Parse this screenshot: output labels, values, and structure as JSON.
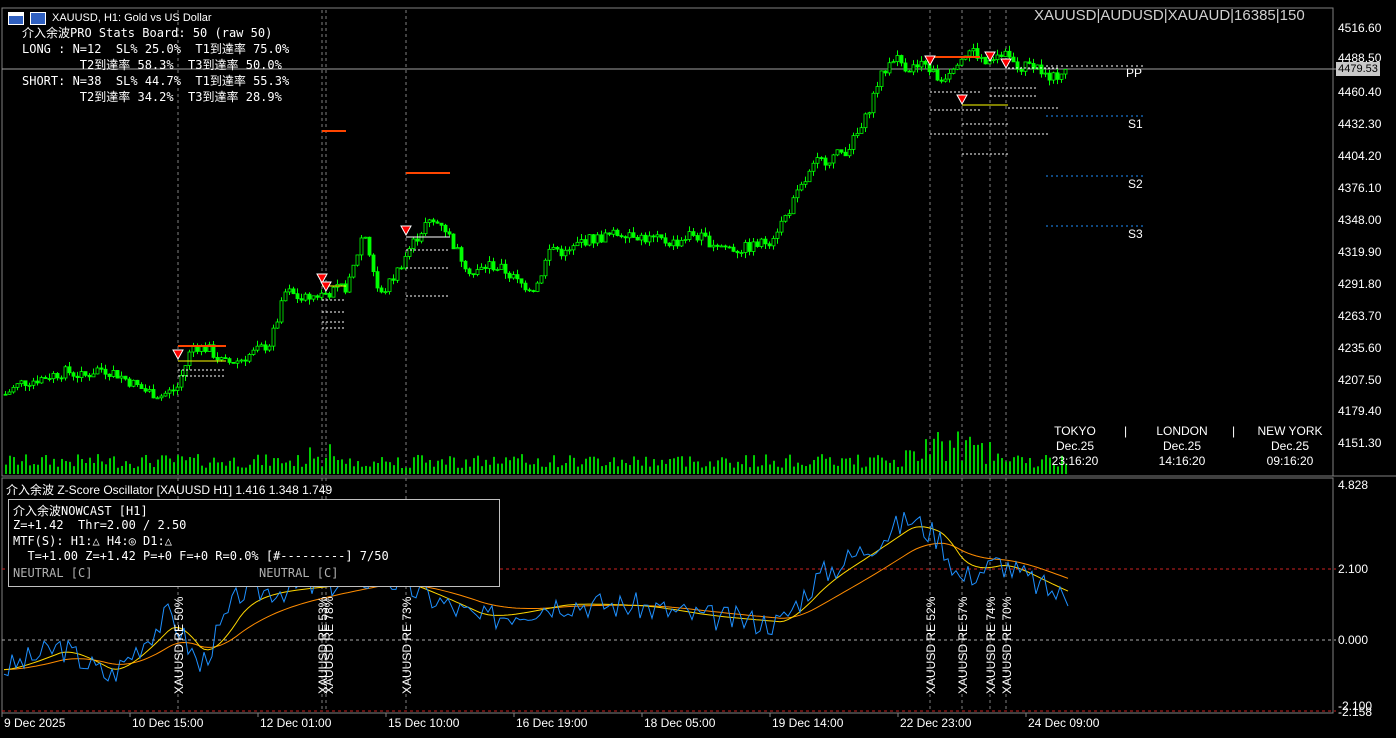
{
  "window": {
    "title": "XAUUSD, H1:  Gold vs US Dollar",
    "symbol_header": "XAUUSD|AUDUSD|XAUAUD|16385|150"
  },
  "stats_board": {
    "line1": "介入余波PRO Stats Board: 50 (raw 50)",
    "line2": "LONG : N=12  SL% 25.0%  T1到達率 75.0%",
    "line3": "        T2到達率 58.3%  T3到達率 50.0%",
    "line4": "SHORT: N=38  SL% 44.7%  T1到達率 55.3%",
    "line5": "        T2到達率 34.2%  T3到達率 28.9%"
  },
  "price_axis": {
    "labels": [
      "4516.60",
      "4488.50",
      "4460.40",
      "4432.30",
      "4404.20",
      "4376.10",
      "4348.00",
      "4319.90",
      "4291.80",
      "4263.70",
      "4235.60",
      "4207.50",
      "4179.40",
      "4151.30"
    ],
    "current_price": "4479.53"
  },
  "pivots": {
    "pp": "PP",
    "s1": "S1",
    "s2": "S2",
    "s3": "S3"
  },
  "sessions": [
    {
      "name": "TOKYO",
      "date": "Dec.25",
      "time": "23:16:20"
    },
    {
      "name": "LONDON",
      "date": "Dec.25",
      "time": "14:16:20"
    },
    {
      "name": "NEW YORK",
      "date": "Dec.25",
      "time": "09:16:20"
    }
  ],
  "session_sep": "|",
  "oscillator": {
    "header": "介入余波 Z-Score Oscillator [XAUUSD H1] 1.416 1.348 1.749",
    "axis_labels": [
      "4.828",
      "2.100",
      "0.000",
      "-2.100",
      "-2.158"
    ]
  },
  "nowcast": {
    "title": "介入余波NOWCAST [H1]",
    "z_line": "Z=+1.42  Thr=2.00 / 2.50",
    "mtf_line": "MTF(S): H1:△ H4:◎ D1:△",
    "t_line": "  T=+1.00 Z=+1.42 P=+0 F=+0 R=0.0% [#---------] 7/50",
    "status_left": "NEUTRAL [C]",
    "status_right": "NEUTRAL [C]"
  },
  "re_labels": [
    "XAUUSD RE 50%",
    "XAUUSD RE 53%",
    "XAUUSD RE 78%",
    "XAUUSD RE 73%",
    "XAUUSD RE 52%",
    "XAUUSD RE 57%",
    "XAUUSD RE 74%",
    "XAUUSD RE 70%"
  ],
  "time_axis": [
    "9 Dec 2025",
    "10 Dec 15:00",
    "12 Dec 01:00",
    "15 Dec 10:00",
    "16 Dec 19:00",
    "18 Dec 05:00",
    "19 Dec 14:00",
    "22 Dec 23:00",
    "24 Dec 09:00"
  ],
  "colors": {
    "bull": "#00ff00",
    "bear": "#00ff00",
    "volume": "#00cc00",
    "signal": "#ff0000",
    "target": "#ff4500",
    "osc_fast": "#1e90ff",
    "osc_slow": "#ffd700",
    "osc_mid": "#ff8c00"
  },
  "chart_data": {
    "type": "candlestick",
    "y_range": [
      4151.3,
      4516.6
    ],
    "close_path": [
      4195,
      4205,
      4208,
      4212,
      4215,
      4210,
      4218,
      4214,
      4206,
      4198,
      4194,
      4200,
      4238,
      4235,
      4222,
      4225,
      4232,
      4240,
      4286,
      4278,
      4282,
      4285,
      4290,
      4340,
      4280,
      4300,
      4325,
      4345,
      4346,
      4320,
      4300,
      4309,
      4304,
      4292,
      4288,
      4325,
      4318,
      4330,
      4332,
      4335,
      4338,
      4332,
      4330,
      4328,
      4336,
      4330,
      4325,
      4322,
      4325,
      4330,
      4350,
      4375,
      4398,
      4403,
      4410,
      4430,
      4470,
      4492,
      4480,
      4485,
      4470,
      4488,
      4498,
      4483,
      4494,
      4480,
      4486,
      4470,
      4481
    ]
  }
}
